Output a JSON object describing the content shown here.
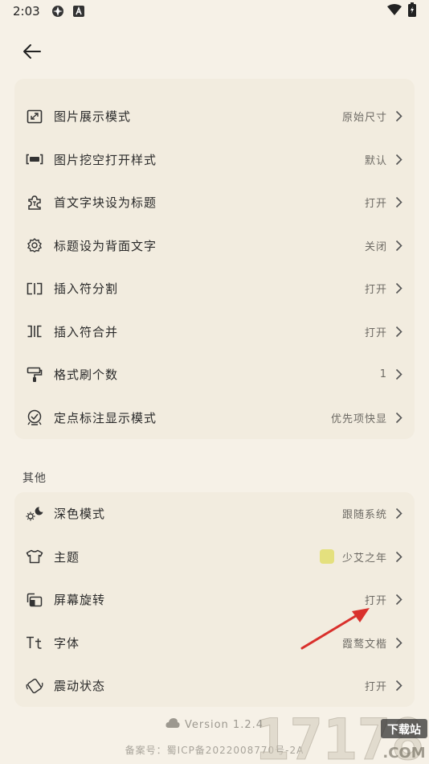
{
  "status": {
    "time": "2:03"
  },
  "settings_top": [
    {
      "label": "图片展示模式",
      "value": "原始尺寸",
      "icon": "image-mode-icon"
    },
    {
      "label": "图片挖空打开样式",
      "value": "默认",
      "icon": "cloze-style-icon"
    },
    {
      "label": "首文字块设为标题",
      "value": "打开",
      "icon": "puzzle-title-icon"
    },
    {
      "label": "标题设为背面文字",
      "value": "关闭",
      "icon": "gear-back-icon"
    },
    {
      "label": "插入符分割",
      "value": "打开",
      "icon": "split-icon"
    },
    {
      "label": "插入符合并",
      "value": "打开",
      "icon": "merge-icon"
    },
    {
      "label": "格式刷个数",
      "value": "1",
      "icon": "format-brush-icon"
    },
    {
      "label": "定点标注显示模式",
      "value": "优先项快显",
      "icon": "pin-annotation-icon"
    }
  ],
  "other_section": {
    "title": "其他",
    "items": [
      {
        "label": "深色模式",
        "value": "跟随系统",
        "icon": "dark-mode-icon"
      },
      {
        "label": "主题",
        "value": "少艾之年",
        "icon": "shirt-icon",
        "swatch": "#e4e07e"
      },
      {
        "label": "屏幕旋转",
        "value": "打开",
        "icon": "rotate-icon"
      },
      {
        "label": "字体",
        "value": "霞鹜文楷",
        "icon": "font-icon"
      },
      {
        "label": "震动状态",
        "value": "打开",
        "icon": "vibrate-icon"
      }
    ]
  },
  "footer": {
    "version": "Version 1.2.4",
    "icp": "备案号：蜀ICP备2022008770号-2A"
  },
  "watermark": {
    "digits": "17178",
    "badge": "下载站",
    "domain": ".COM"
  },
  "colors": {
    "background": "#f6f1e7",
    "card": "#f2ecdf",
    "arrow": "#d9302c"
  }
}
